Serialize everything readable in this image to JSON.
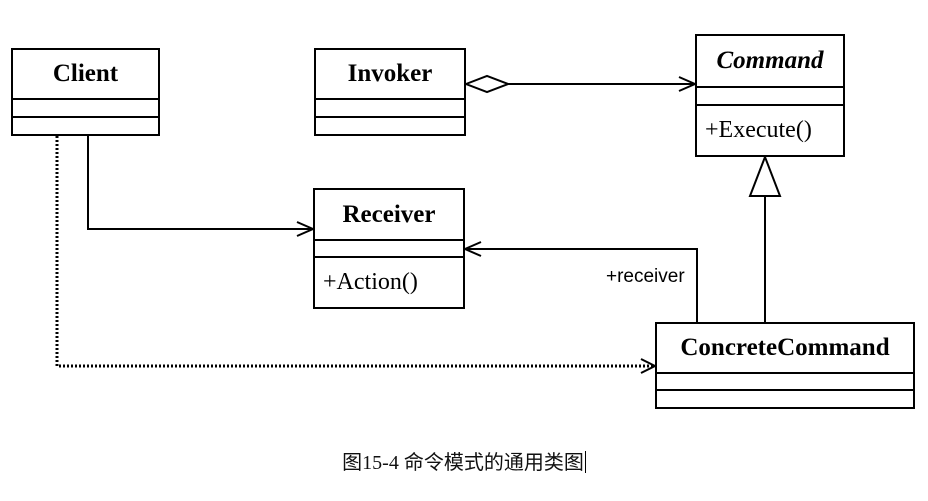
{
  "classes": {
    "client": {
      "name": "Client"
    },
    "invoker": {
      "name": "Invoker"
    },
    "command": {
      "name": "Command",
      "operation": "+Execute()"
    },
    "receiver": {
      "name": "Receiver",
      "operation": "+Action()"
    },
    "concrete_command": {
      "name": "ConcreteCommand"
    }
  },
  "relations": {
    "receiver_role": "+receiver"
  },
  "caption": "图15-4 命令模式的通用类图"
}
